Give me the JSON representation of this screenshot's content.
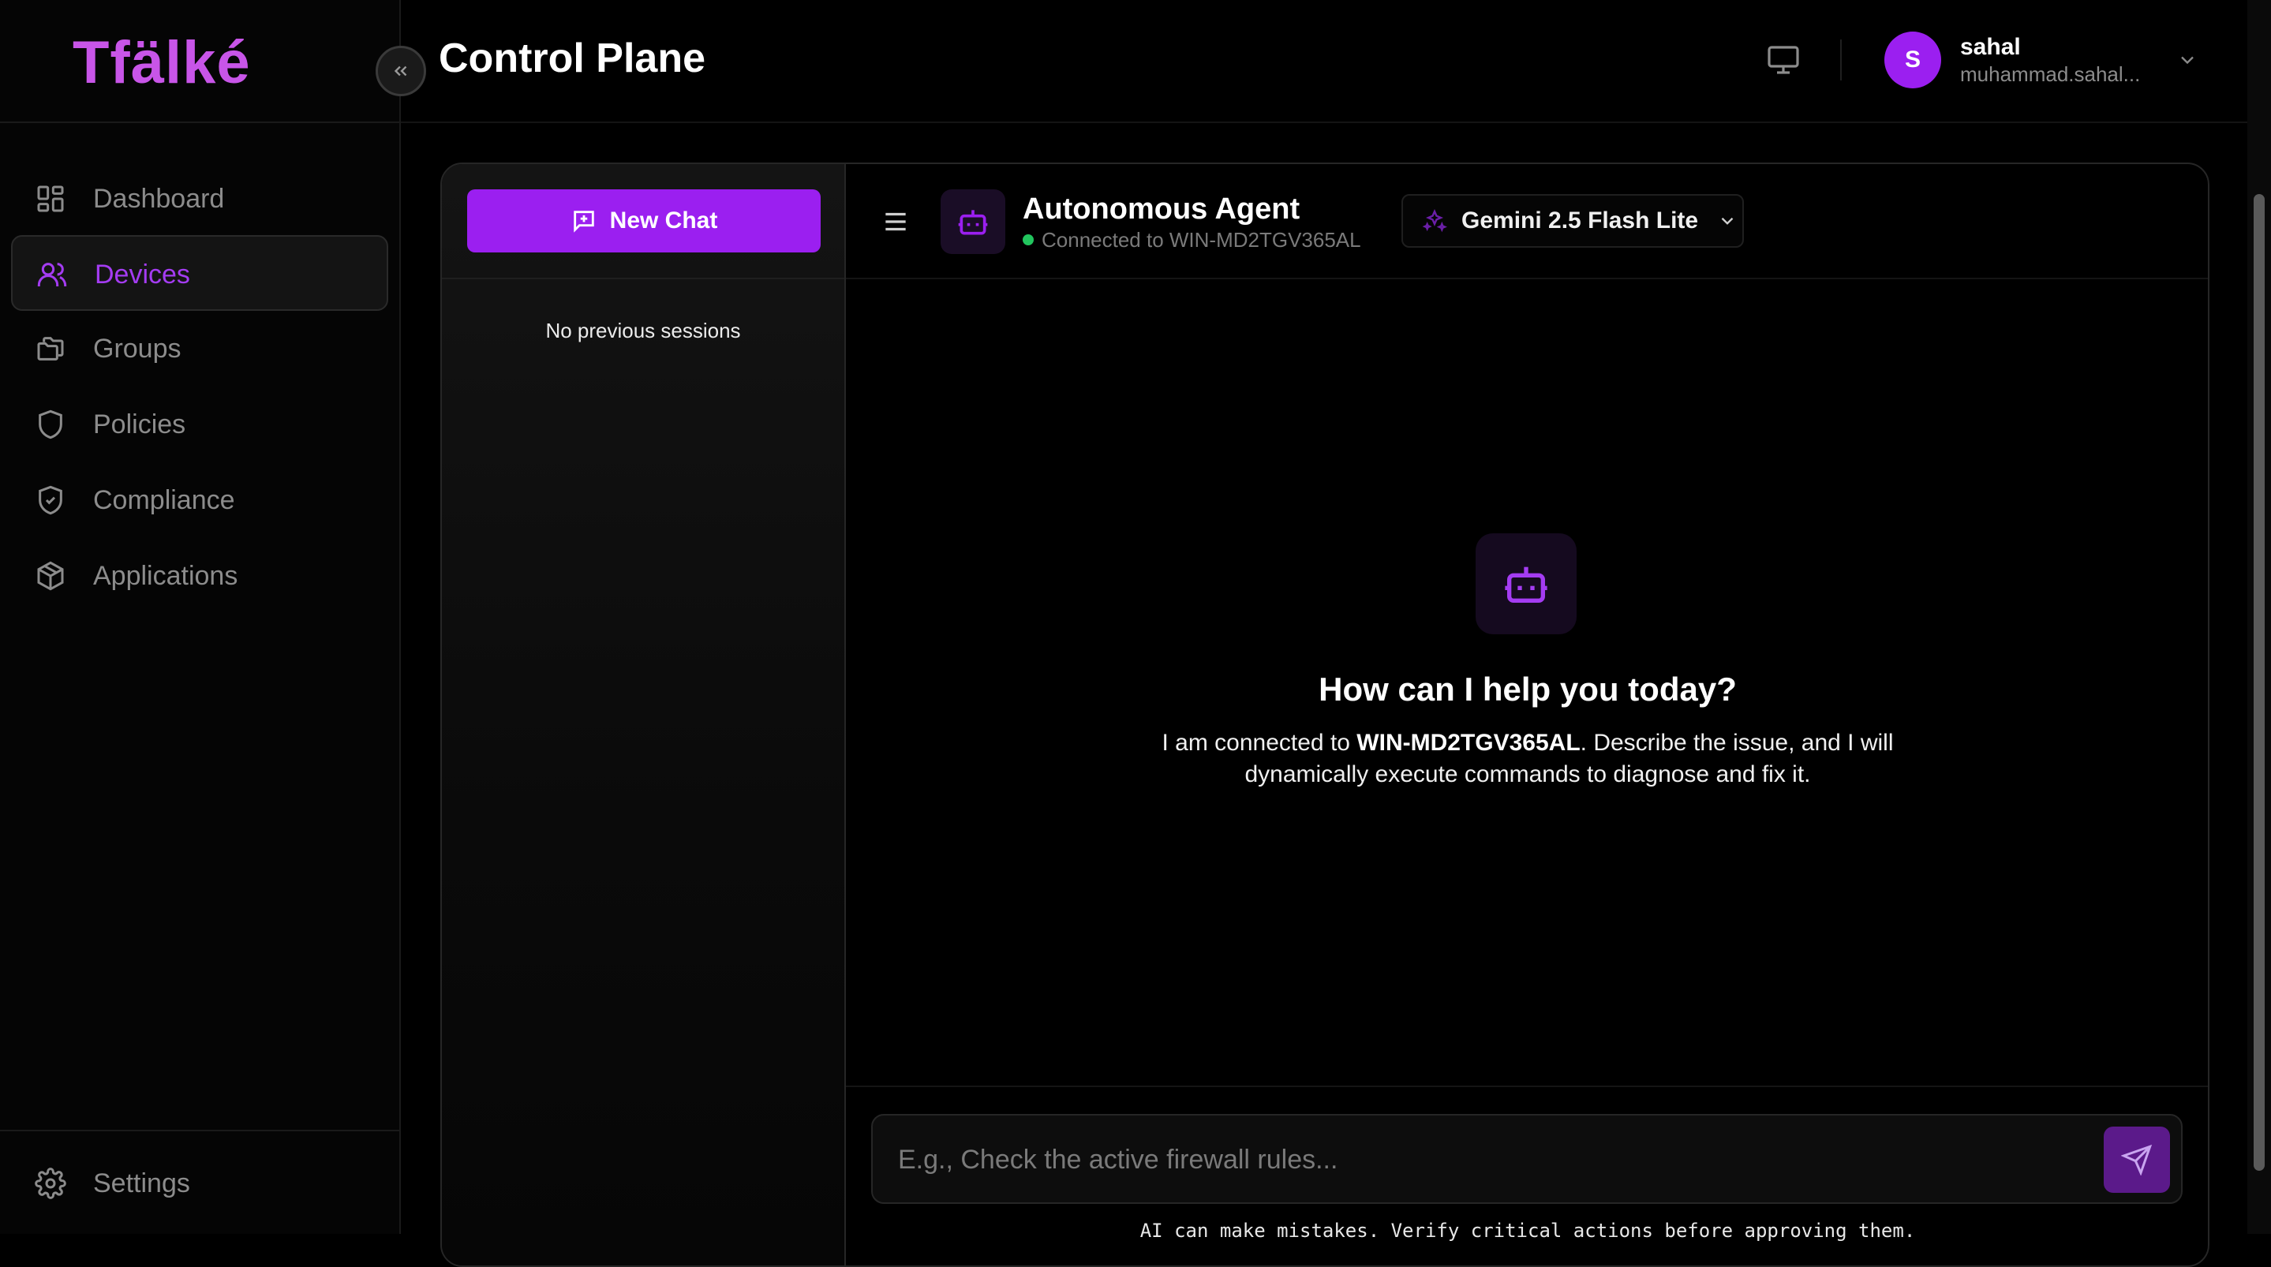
{
  "brand": {
    "logo_text": "Tfälké",
    "accent": "#9b1ff0"
  },
  "sidebar": {
    "items": [
      {
        "label": "Dashboard",
        "icon": "dashboard-grid-icon",
        "active": false
      },
      {
        "label": "Devices",
        "icon": "users-icon",
        "active": true
      },
      {
        "label": "Groups",
        "icon": "folders-icon",
        "active": false
      },
      {
        "label": "Policies",
        "icon": "shield-icon",
        "active": false
      },
      {
        "label": "Compliance",
        "icon": "shield-check-icon",
        "active": false
      },
      {
        "label": "Applications",
        "icon": "package-icon",
        "active": false
      }
    ],
    "settings_label": "Settings"
  },
  "header": {
    "title": "Control Plane",
    "user": {
      "initial": "S",
      "name": "sahal",
      "email": "muhammad.sahal..."
    }
  },
  "sessions": {
    "new_chat_label": "New Chat",
    "empty_text": "No previous sessions"
  },
  "chat": {
    "agent_title": "Autonomous Agent",
    "status_text": "Connected to WIN-MD2TGV365AL",
    "status_color": "#22c55e",
    "model": "Gemini 2.5 Flash Lite",
    "welcome_title": "How can I help you today?",
    "welcome_prefix": "I am connected to ",
    "device_name": "WIN-MD2TGV365AL",
    "welcome_suffix": ". Describe the issue, and I will dynamically execute commands to diagnose and fix it.",
    "input_placeholder": "E.g., Check the active firewall rules...",
    "disclaimer": "AI can make mistakes. Verify critical actions before approving them."
  }
}
